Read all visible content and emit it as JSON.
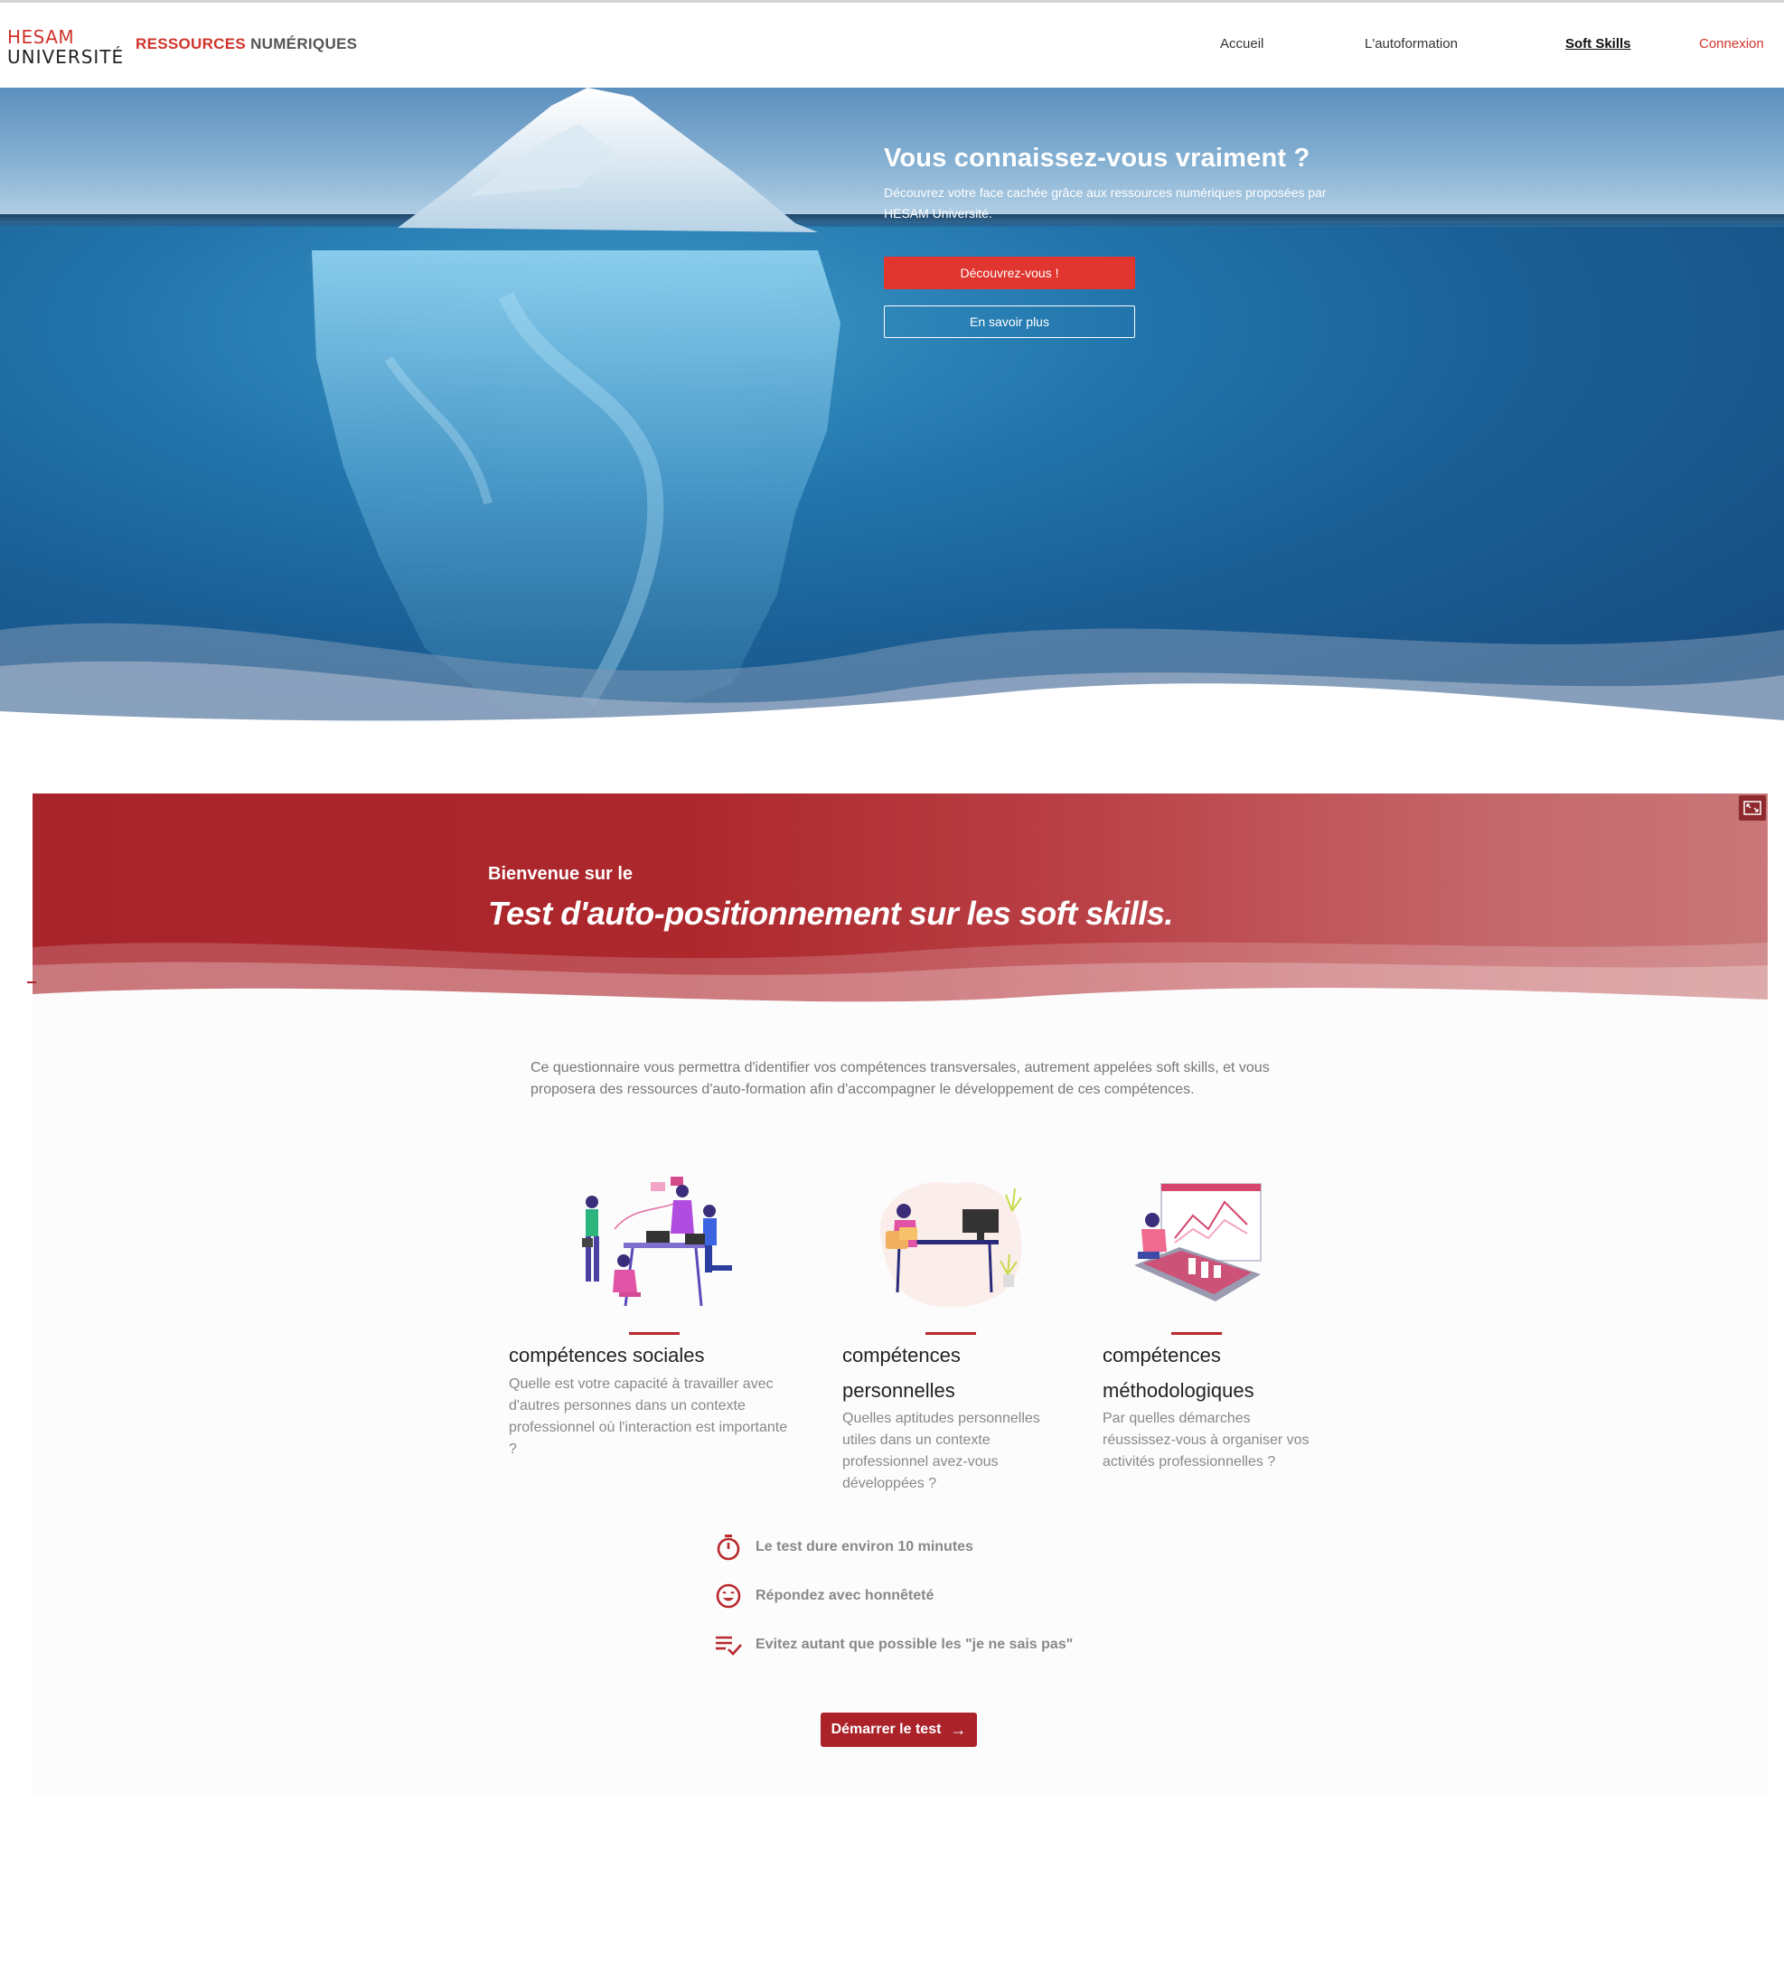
{
  "header": {
    "logo_line1": "HESAM",
    "logo_line2": "UNIVERSITÉ",
    "brand_red": "RESSOURCES",
    "brand_grey": "NUMÉRIQUES",
    "nav": [
      {
        "label": "Accueil",
        "active": false
      },
      {
        "label": "L'autoformation",
        "active": false
      },
      {
        "label": "Soft Skills",
        "active": true
      },
      {
        "label": "Connexion",
        "active": false
      }
    ]
  },
  "hero": {
    "title": "Vous connaissez-vous vraiment ?",
    "subtitle": "Découvrez votre face cachée grâce aux ressources numériques proposées par HESAM Université.",
    "primary_button": "Découvrez-vous !",
    "secondary_button": "En savoir plus"
  },
  "quiz": {
    "welcome": "Bienvenue sur le",
    "title": "Test d'auto-positionnement sur les soft skills.",
    "intro": "Ce questionnaire vous permettra d'identifier vos compétences transversales, autrement appelées soft skills, et vous proposera des ressources d'auto-formation afin d'accompagner le développement de ces compétences.",
    "skills": [
      {
        "title": "compétences sociales",
        "description": "Quelle est votre capacité à travailler avec d'autres personnes dans un contexte professionnel où l'interaction est importante ?"
      },
      {
        "title": "compétences personnelles",
        "description": "Quelles aptitudes personnelles utiles dans un contexte professionnel avez-vous développées ?"
      },
      {
        "title": "compétences méthodologiques",
        "description": "Par quelles démarches réussissez-vous à organiser vos activités professionnelles ?"
      }
    ],
    "rules": [
      {
        "icon": "timer-icon",
        "text": "Le test dure environ 10 minutes"
      },
      {
        "icon": "smiley-icon",
        "text": "Répondez avec honnêteté"
      },
      {
        "icon": "checklist-icon",
        "text": "Evitez autant que possible les \"je ne sais pas\""
      }
    ],
    "start_button": "Démarrer le test"
  },
  "colors": {
    "brand_red": "#d0342c",
    "banner_red": "#a8242b",
    "button_red": "#e0362f",
    "start_red": "#ab2229"
  }
}
